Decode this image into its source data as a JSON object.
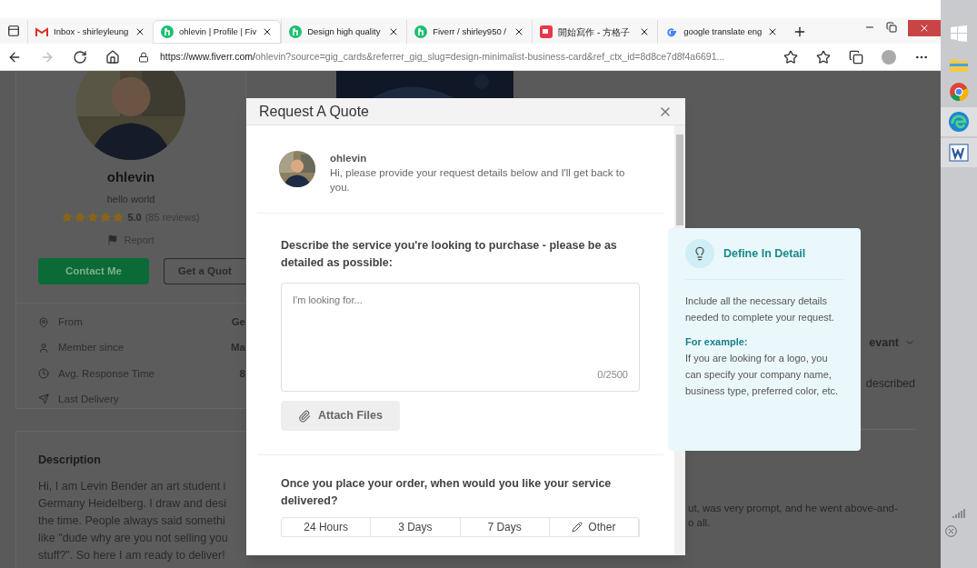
{
  "browser": {
    "tabs": [
      {
        "kind": "gmail",
        "title": "Inbox - shirleyleung",
        "selected": false
      },
      {
        "kind": "fiverr",
        "title": "ohlevin | Profile | Fiv",
        "selected": true
      },
      {
        "kind": "fiverr",
        "title": "Design high quality",
        "selected": false
      },
      {
        "kind": "fiverr",
        "title": "Fiverr / shirley950 /",
        "selected": false
      },
      {
        "kind": "vocus",
        "title": "開始寫作 - 方格子",
        "selected": false
      },
      {
        "kind": "google",
        "title": "google translate eng",
        "selected": false
      }
    ],
    "url_host": "https://www.fiverr.com/",
    "url_rest": "ohlevin?source=gig_cards&referrer_gig_slug=design-minimalist-business-card&ref_ctx_id=8d8ce7d8f4a6691..."
  },
  "profile": {
    "name": "ohlevin",
    "tagline": "hello world",
    "stars": 5,
    "rating": "5.0",
    "reviews": "(85 reviews)",
    "report": "Report",
    "contact_button": "Contact Me",
    "quote_button": "Get a Quot",
    "info": [
      {
        "kind": "pin",
        "label": "From",
        "value": "Ge"
      },
      {
        "kind": "user",
        "label": "Member since",
        "value": "Ma"
      },
      {
        "kind": "clock",
        "label": "Avg. Response Time",
        "value": "8"
      },
      {
        "kind": "plane",
        "label": "Last Delivery"
      }
    ]
  },
  "description": {
    "title": "Description",
    "lines": [
      "Hi, I am Levin Bender an art student i",
      "Germany Heidelberg. I draw and desi",
      "the time. People always said somethi",
      "like \"dude why are you not selling you",
      "stuff?\". So here I am ready to deliver!"
    ]
  },
  "reviews": {
    "sort": "evant",
    "snippet": "described",
    "review_lines": [
      "ut, was very prompt, and he went above-and-",
      "o all."
    ]
  },
  "modal": {
    "title": "Request A Quote",
    "seller_name": "ohlevin",
    "seller_message": "Hi, please provide your request details below and I'll get back to you.",
    "describe_label": "Describe the service you're looking to purchase - please be as detailed as possible:",
    "placeholder": "I'm looking for...",
    "counter": "0/2500",
    "attach_button": "Attach Files",
    "delivery_label": "Once you place your order, when would you like your service delivered?",
    "delivery_options": [
      {
        "kind": "preset",
        "label": "24 Hours"
      },
      {
        "kind": "preset",
        "label": "3 Days"
      },
      {
        "kind": "preset",
        "label": "7 Days"
      },
      {
        "kind": "custom",
        "label": "Other"
      }
    ]
  },
  "tip": {
    "title": "Define In Detail",
    "body": "Include all the necessary details needed to complete your request.",
    "example_title": "For example:",
    "example_body": "If you are looking for a logo, you can specify your company name, business type, preferred color, etc."
  }
}
